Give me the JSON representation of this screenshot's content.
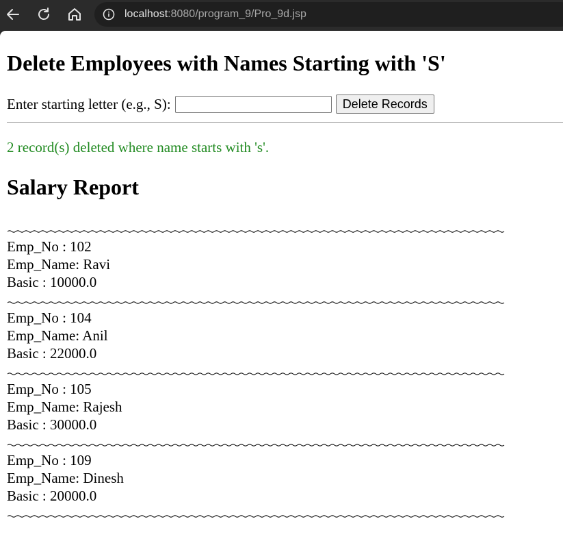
{
  "browser": {
    "url_host": "localhost",
    "url_path": ":8080/program_9/Pro_9d.jsp"
  },
  "page": {
    "title": "Delete Employees with Names Starting with 'S'",
    "form": {
      "label": "Enter starting letter (e.g., S):",
      "input_value": "",
      "button_label": "Delete Records"
    },
    "status": {
      "message": "2 record(s) deleted where name starts with 's'.",
      "color": "#228b22"
    },
    "report": {
      "heading": "Salary Report",
      "records": [
        {
          "emp_no": "Emp_No : 102",
          "emp_name": "Emp_Name: Ravi",
          "basic": "Basic : 10000.0"
        },
        {
          "emp_no": "Emp_No : 104",
          "emp_name": "Emp_Name: Anil",
          "basic": "Basic : 22000.0"
        },
        {
          "emp_no": "Emp_No : 105",
          "emp_name": "Emp_Name: Rajesh",
          "basic": "Basic : 30000.0"
        },
        {
          "emp_no": "Emp_No : 109",
          "emp_name": "Emp_Name: Dinesh",
          "basic": "Basic : 20000.0"
        }
      ]
    }
  },
  "icons": {
    "back": "back-arrow-icon",
    "reload": "reload-icon",
    "home": "home-icon",
    "info": "info-icon"
  }
}
